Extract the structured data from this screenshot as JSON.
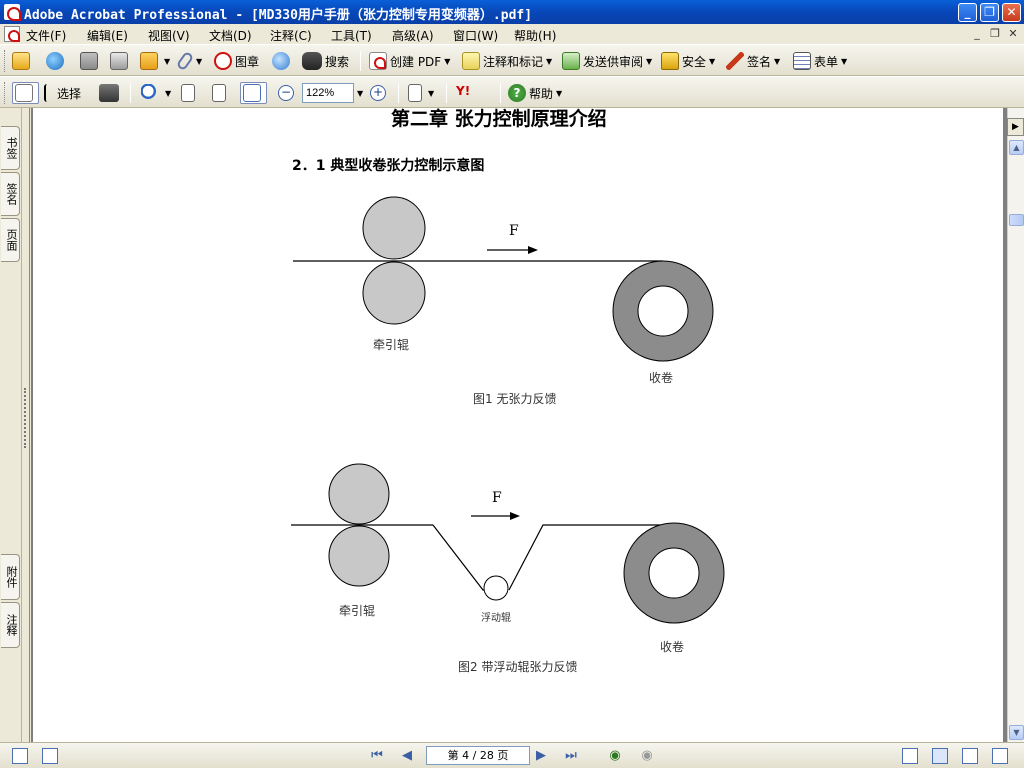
{
  "window": {
    "title": "Adobe Acrobat Professional - [MD330用户手册（张力控制专用变频器）.pdf]",
    "buttons": {
      "minimize": "_",
      "maximize": "❐",
      "close": "✕"
    }
  },
  "menubar": {
    "items": [
      "文件(F)",
      "编辑(E)",
      "视图(V)",
      "文档(D)",
      "注释(C)",
      "工具(T)",
      "高级(A)",
      "窗口(W)",
      "帮助(H)"
    ],
    "mdi": {
      "minimize": "_",
      "restore": "❐",
      "close": "✕"
    }
  },
  "toolbar1": {
    "stamp": "图章",
    "search": "搜索",
    "create_pdf": "创建 PDF",
    "comment": "注释和标记",
    "send_review": "发送供审阅",
    "secure": "安全",
    "sign": "签名",
    "forms": "表单"
  },
  "toolbar2": {
    "select": "选择",
    "zoom_value": "122%",
    "zoom_out": "−",
    "zoom_in": "+",
    "help": "帮助",
    "yahoo": "Y!"
  },
  "side_tabs": {
    "bookmarks": "书签",
    "signatures": "签名",
    "pages": "页面",
    "attachments": "附件",
    "comments": "注释"
  },
  "document": {
    "chapter_title": "第二章   张力控制原理介绍",
    "section_title": "2．1   典型收卷张力控制示意图",
    "fig1": {
      "force": "F",
      "roller": "牵引辊",
      "winder": "收卷",
      "caption": "图1  无张力反馈"
    },
    "fig2": {
      "force": "F",
      "roller": "牵引辊",
      "dancer": "浮动辊",
      "winder": "收卷",
      "caption": "图2  带浮动辊张力反馈"
    }
  },
  "statusbar": {
    "page_display": "第 4 / 28 页"
  }
}
